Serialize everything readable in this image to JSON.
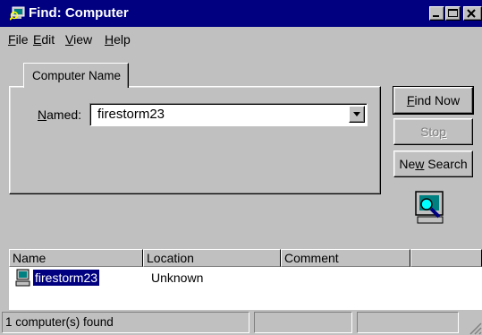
{
  "window": {
    "title": "Find: Computer",
    "icon": "find-computer-icon"
  },
  "menu": {
    "items": [
      {
        "label_u": "F",
        "label_rest": "ile"
      },
      {
        "label_u": "E",
        "label_rest": "dit"
      },
      {
        "label_u": "V",
        "label_rest": "iew"
      },
      {
        "label_u": "H",
        "label_rest": "elp"
      }
    ]
  },
  "tab": {
    "label": "Computer Name"
  },
  "named": {
    "label_u": "N",
    "label_rest": "amed:",
    "value": "firestorm23"
  },
  "buttons": {
    "find_now_u": "F",
    "find_now_rest": "ind Now",
    "stop_pre": "Sto",
    "stop_u": "p",
    "new_search_pre": "Ne",
    "new_search_u": "w",
    "new_search_rest": " Search"
  },
  "results": {
    "columns": [
      "Name",
      "Location",
      "Comment"
    ],
    "rows": [
      {
        "name": "firestorm23",
        "location": "Unknown",
        "comment": ""
      }
    ]
  },
  "status": {
    "text": "1 computer(s) found"
  },
  "colors": {
    "titlebar": "#000080",
    "face": "#c0c0c0",
    "selection": "#000080"
  }
}
